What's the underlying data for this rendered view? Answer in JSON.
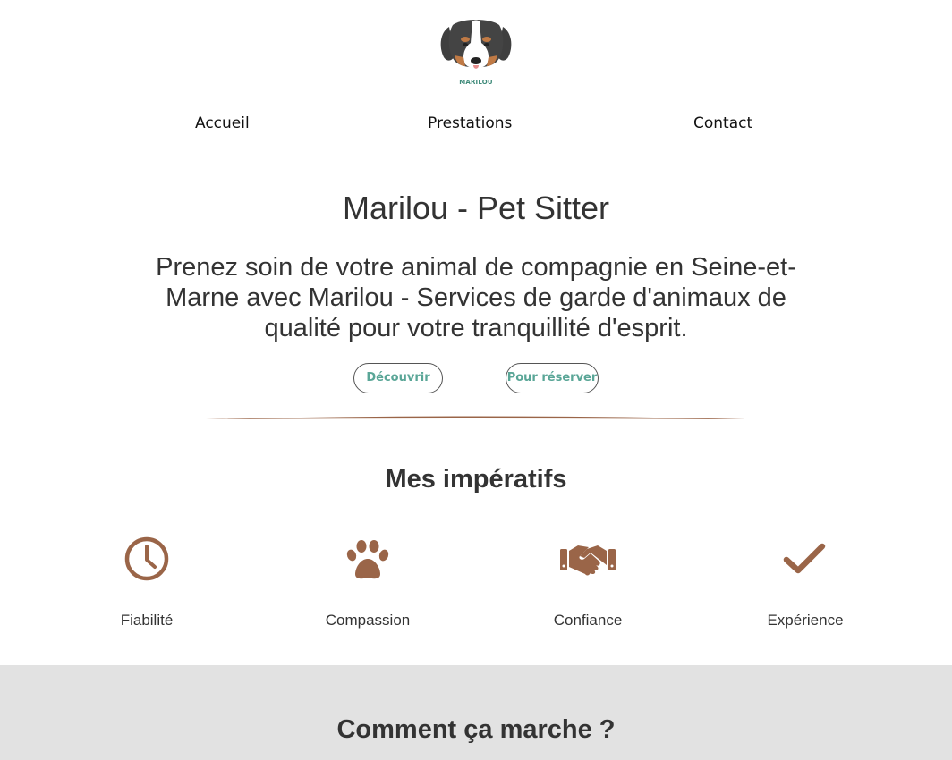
{
  "brand": {
    "logo_text": "MARILOU",
    "logo_icon": "dog-head-icon"
  },
  "nav": {
    "items": [
      {
        "label": "Accueil"
      },
      {
        "label": "Prestations"
      },
      {
        "label": "Contact"
      }
    ]
  },
  "hero": {
    "title": "Marilou - Pet Sitter",
    "subtitle": "Prenez soin de votre animal de compagnie en Seine-et-Marne avec Marilou - Services de garde d'animaux de qualité pour votre tranquillité d'esprit.",
    "buttons": {
      "discover": "Découvrir",
      "book": "Pour réserver"
    }
  },
  "imperatifs": {
    "title": "Mes impératifs",
    "items": [
      {
        "label": "Fiabilité",
        "icon": "clock-icon"
      },
      {
        "label": "Compassion",
        "icon": "paw-icon"
      },
      {
        "label": "Confiance",
        "icon": "handshake-icon"
      },
      {
        "label": "Expérience",
        "icon": "checkmark-icon"
      }
    ]
  },
  "how_it_works": {
    "title": "Comment ça marche ?"
  },
  "colors": {
    "accent_brown": "#9a6548",
    "accent_green": "#5aa697",
    "band_gray": "#e2e2e2"
  }
}
